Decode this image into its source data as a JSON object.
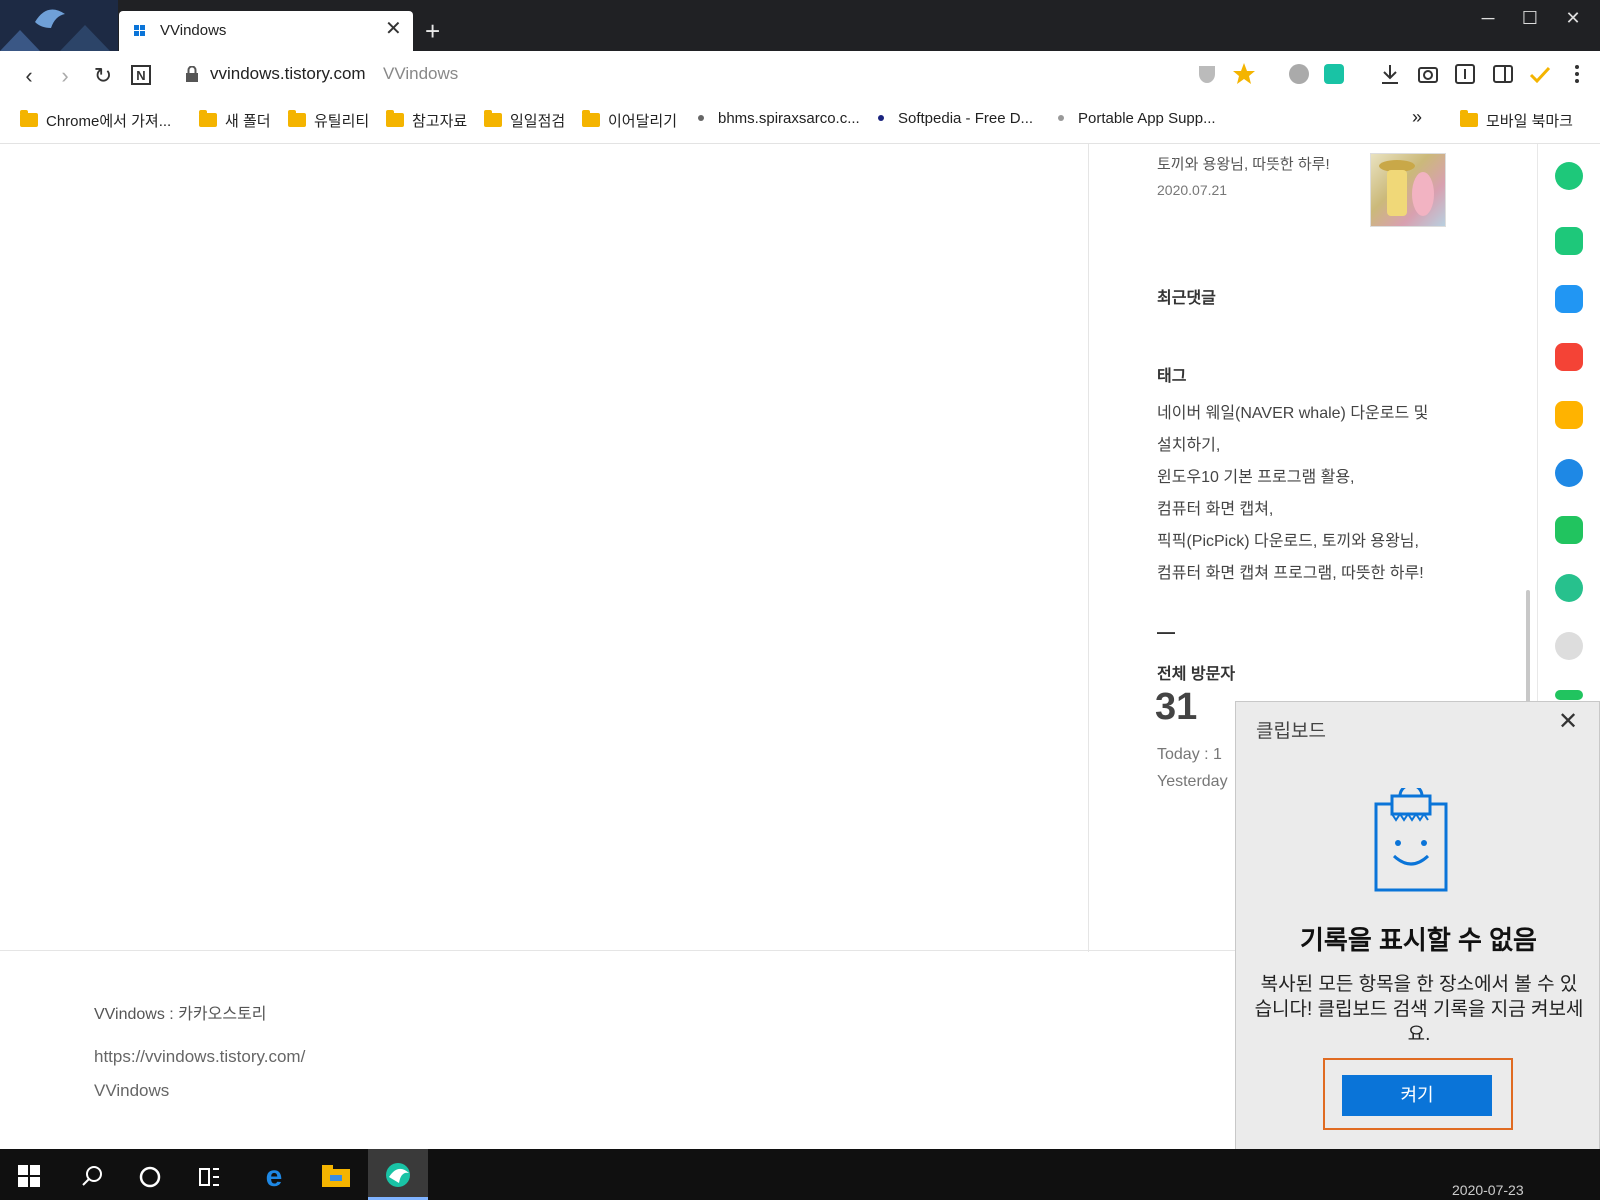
{
  "browser": {
    "tab_title": "VVindows",
    "url": "vvindows.tistory.com",
    "url_title": "VVindows"
  },
  "bookmarks": [
    {
      "label": "Chrome에서 가져...",
      "type": "folder"
    },
    {
      "label": "새 폴더",
      "type": "folder"
    },
    {
      "label": "유틸리티",
      "type": "folder"
    },
    {
      "label": "참고자료",
      "type": "folder"
    },
    {
      "label": "일일점검",
      "type": "folder"
    },
    {
      "label": "이어달리기",
      "type": "folder"
    },
    {
      "label": "bhms.spiraxsarco.c...",
      "type": "link"
    },
    {
      "label": "Softpedia - Free D...",
      "type": "link"
    },
    {
      "label": "Portable App Supp...",
      "type": "link"
    }
  ],
  "bookmarks_more": "»",
  "mobile_bookmarks": "모바일 북마크",
  "sidebar": {
    "recent_post_title": "토끼와 용왕님, 따뜻한 하루!",
    "recent_post_date": "2020.07.21",
    "recent_comments_heading": "최근댓글",
    "tags_heading": "태그",
    "tags": [
      "네이버 웨일(NAVER whale) 다운로드 및",
      "설치하기,",
      "윈도우10 기본 프로그램 활용,",
      "컴퓨터 화면 캡쳐,",
      "픽픽(PicPick) 다운로드,  토끼와 용왕님,",
      "컴퓨터 화면 캡쳐 프로그램,  따뜻한 하루!"
    ],
    "visitor_dash": "—",
    "visitors_heading": "전체 방문자",
    "visitors_total": "31",
    "today": "Today : 1",
    "yesterday": "Yesterday"
  },
  "footer": {
    "blog_line": "VVindows : 카카오스토리",
    "url": "https://vvindows.tistory.com/",
    "name": "VVindows"
  },
  "clipboard": {
    "title": "클립보드",
    "heading": "기록을 표시할 수 없음",
    "description": "복사된 모든 항목을 한 장소에서 볼 수 있습니다! 클립보드 검색 기록을 지금 켜보세요.",
    "button": "켜기"
  },
  "taskbar": {
    "date": "2020-07-23"
  },
  "colors": {
    "accent_button": "#0a74d8",
    "focus_outline": "#e06b22",
    "star": "#f4b400"
  }
}
